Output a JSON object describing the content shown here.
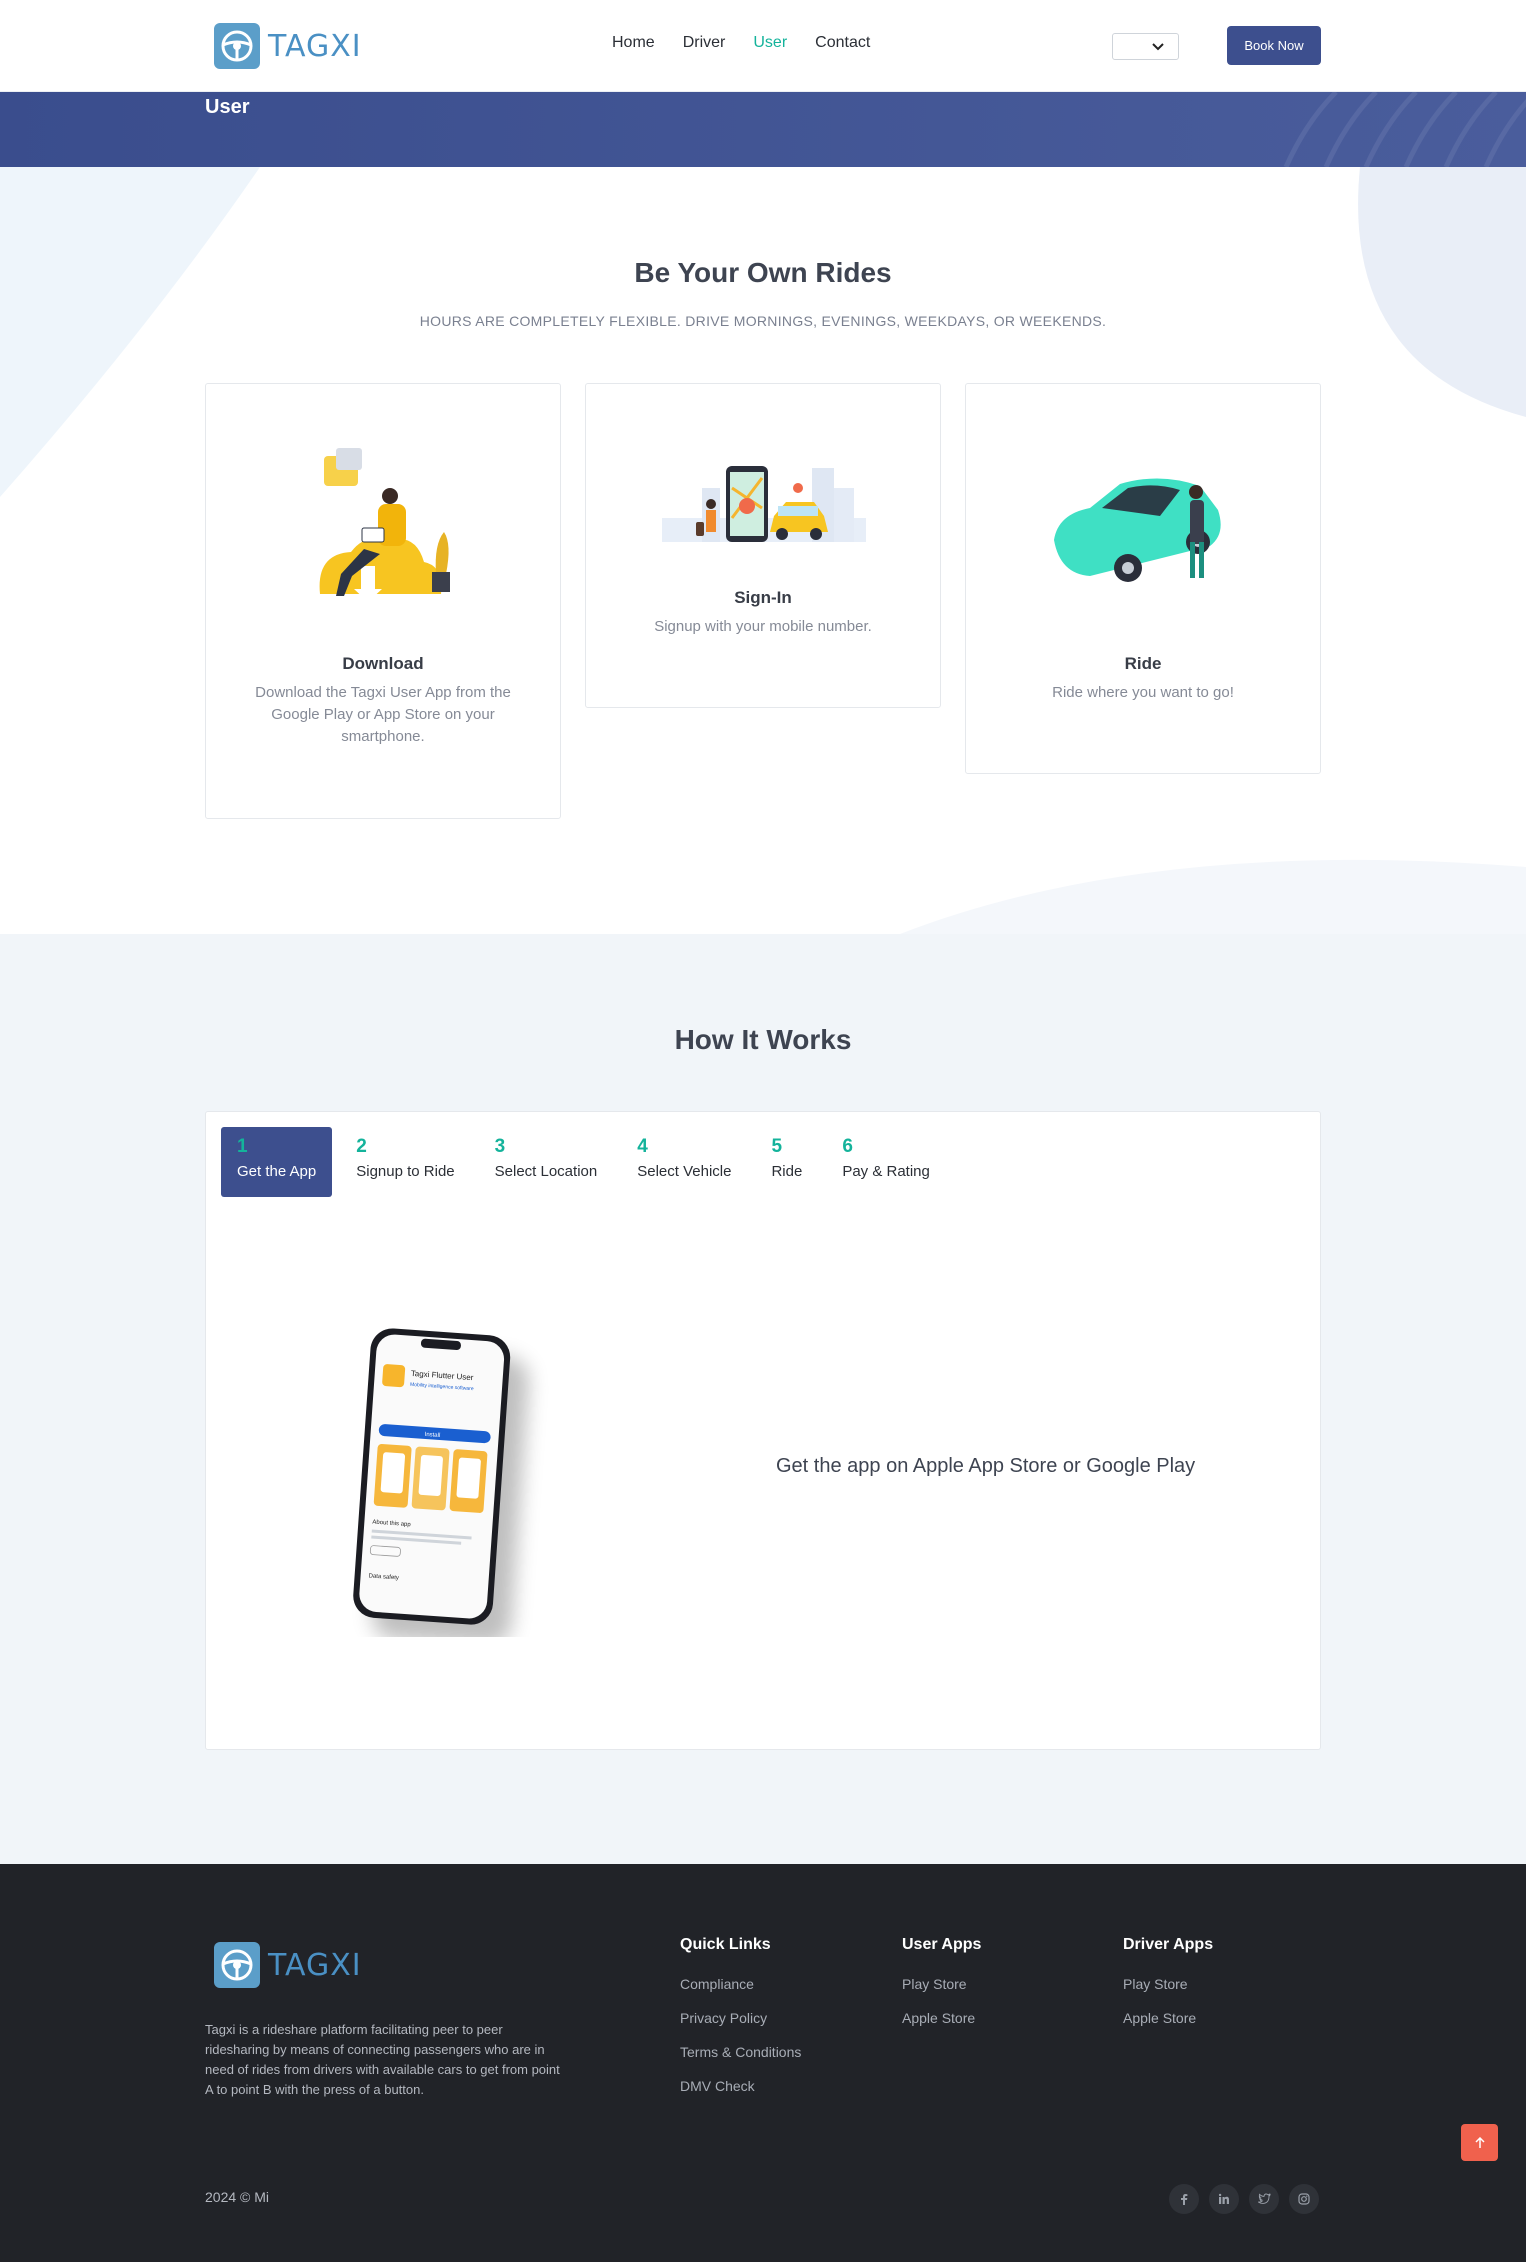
{
  "brand": {
    "name": "TAGXI",
    "logo_icon": "steering-wheel-icon"
  },
  "nav": {
    "links": [
      "Home",
      "Driver",
      "User",
      "Contact"
    ],
    "active": "User",
    "language_value": "",
    "book_label": "Book Now"
  },
  "banner": {
    "title": "User"
  },
  "hero": {
    "title": "Be Your Own Rides",
    "subtitle": "HOURS ARE COMPLETELY FLEXIBLE. DRIVE MORNINGS, EVENINGS, WEEKDAYS, OR WEEKENDS.",
    "cards": [
      {
        "title": "Download",
        "desc": "Download the Tagxi User App from the Google Play or App Store on your smartphone."
      },
      {
        "title": "Sign-In",
        "desc": "Signup with your mobile number."
      },
      {
        "title": "Ride",
        "desc": "Ride where you want to go!"
      }
    ]
  },
  "how": {
    "title": "How It Works",
    "tabs": [
      {
        "num": "1",
        "label": "Get the App"
      },
      {
        "num": "2",
        "label": "Signup to Ride"
      },
      {
        "num": "3",
        "label": "Select Location"
      },
      {
        "num": "4",
        "label": "Select Vehicle"
      },
      {
        "num": "5",
        "label": "Ride"
      },
      {
        "num": "6",
        "label": "Pay & Rating"
      }
    ],
    "active_tab": 0,
    "content_text": "Get the app on Apple App Store or Google Play",
    "phone_app": {
      "name": "Tagxi Flutter User",
      "developer": "Mobility intelligence software",
      "install": "Install",
      "about": "About this app",
      "data_safety": "Data safety"
    }
  },
  "footer": {
    "about": "Tagxi is a rideshare platform facilitating peer to peer ridesharing by means of connecting passengers who are in need of rides from drivers with available cars to get from point A to point B with the press of a button.",
    "quick_links": {
      "title": "Quick Links",
      "items": [
        "Compliance",
        "Privacy Policy",
        "Terms & Conditions",
        "DMV Check"
      ]
    },
    "user_apps": {
      "title": "User Apps",
      "items": [
        "Play Store",
        "Apple Store"
      ]
    },
    "driver_apps": {
      "title": "Driver Apps",
      "items": [
        "Play Store",
        "Apple Store"
      ]
    },
    "copyright": "2024 © Mi",
    "social": [
      "facebook-icon",
      "linkedin-icon",
      "twitter-icon",
      "instagram-icon"
    ]
  },
  "colors": {
    "primary": "#3d4f8e",
    "accent": "#14b39b",
    "footer": "#212328",
    "to_top": "#f0614d"
  }
}
